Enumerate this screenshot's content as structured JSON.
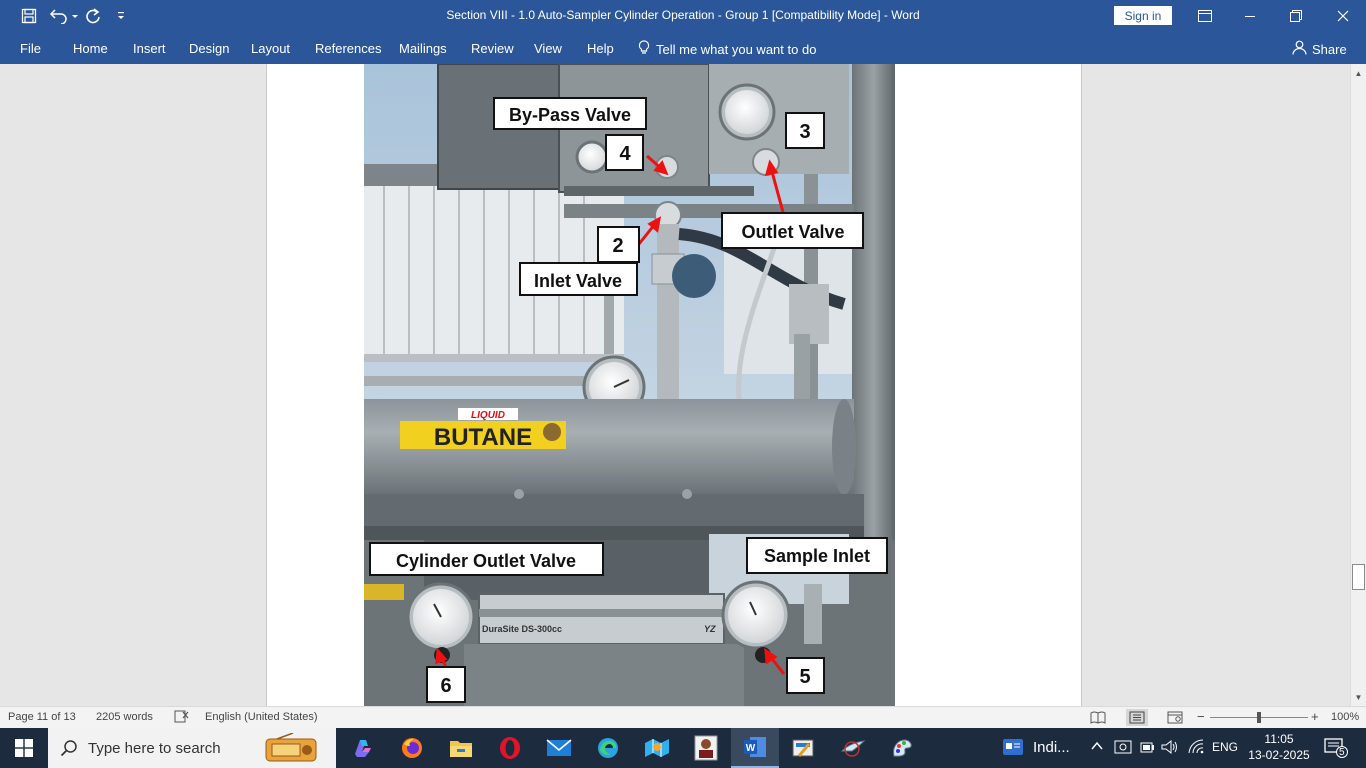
{
  "window": {
    "title": "Section VIII - 1.0 Auto-Sampler Cylinder Operation - Group 1 [Compatibility Mode]  -  Word",
    "sign_in": "Sign in"
  },
  "ribbon": {
    "tabs": [
      "File",
      "Home",
      "Insert",
      "Design",
      "Layout",
      "References",
      "Mailings",
      "Review",
      "View",
      "Help"
    ],
    "tell_me": "Tell me what you want to do",
    "share": "Share"
  },
  "photo": {
    "tank_label": "BUTANE",
    "tank_sublabel": "LIQUID",
    "meter_label": "DuraSite DS-300cc",
    "meter_brand": "YZ",
    "callouts": {
      "bypass": "By-Pass Valve",
      "n4": "4",
      "n3": "3",
      "outlet": "Outlet Valve",
      "n2": "2",
      "inlet": "Inlet Valve",
      "cyl_outlet": "Cylinder Outlet Valve",
      "sample_inlet": "Sample Inlet",
      "n6": "6",
      "n5": "5"
    }
  },
  "status": {
    "page": "Page 11 of 13",
    "words": "2205 words",
    "language": "English (United States)",
    "zoom": "100%"
  },
  "taskbar": {
    "search_placeholder": "Type here to search",
    "weather": "Indi...",
    "language": "ENG",
    "time": "11:05",
    "date": "13-02-2025",
    "notifications": "5"
  }
}
